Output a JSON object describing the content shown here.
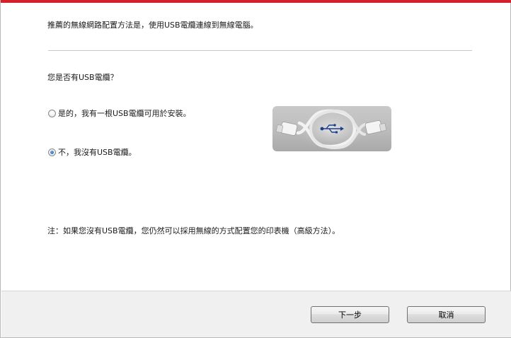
{
  "intro_text": "推薦的無線網路配置方法是，使用USB電纜連線到無線電腦。",
  "question": "您是否有USB電纜？",
  "options": [
    {
      "label": "是的，我有一根USB電纜可用於安裝。",
      "selected": false
    },
    {
      "label": "不，我沒有USB電纜。",
      "selected": true
    }
  ],
  "usb_image_icon": "usb-cable-icon",
  "note": "注：如果您沒有USB電纜，您仍然可以採用無線的方式配置您的印表機（高級方法）。",
  "buttons": {
    "next": "下一步",
    "cancel": "取消"
  },
  "colors": {
    "accent": "#d3202a",
    "usb_symbol": "#1a3f8c"
  }
}
